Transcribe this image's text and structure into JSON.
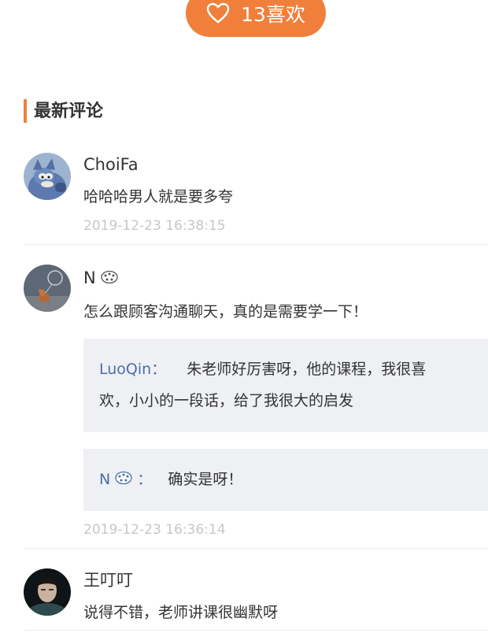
{
  "like_button": {
    "count_label": "13喜欢",
    "icon": "heart-outline-icon"
  },
  "section": {
    "title": "最新评论",
    "accent_color": "#f07f3c"
  },
  "comments": [
    {
      "name": "ChoiFa",
      "text": "哈哈哈男人就是要多夸",
      "time": "2019-12-23 16:38:15",
      "avatar": "tom-cat-avatar"
    },
    {
      "name": "N",
      "name_emoji": "cookie-emoji-icon",
      "text": "怎么跟顾客沟通聊天，真的是需要学一下！",
      "time": "2019-12-23 16:36:14",
      "avatar": "jerry-balloon-avatar",
      "replies": [
        {
          "author": "LuoQin：",
          "line1": "朱老师好厉害呀，他的课程，我很喜",
          "line2": "欢，小小的一段话，给了我很大的启发"
        },
        {
          "author": "N",
          "author_emoji": "cookie-emoji-icon",
          "author_suffix": "：",
          "text": "确实是呀！"
        }
      ]
    },
    {
      "name": "王叮叮",
      "text": "说得不错，老师讲课很幽默呀",
      "avatar": "person-photo-avatar"
    }
  ],
  "colors": {
    "author_link": "#4b6fa8",
    "timestamp": "#c7c7c7",
    "reply_bg": "#eef0f4"
  }
}
